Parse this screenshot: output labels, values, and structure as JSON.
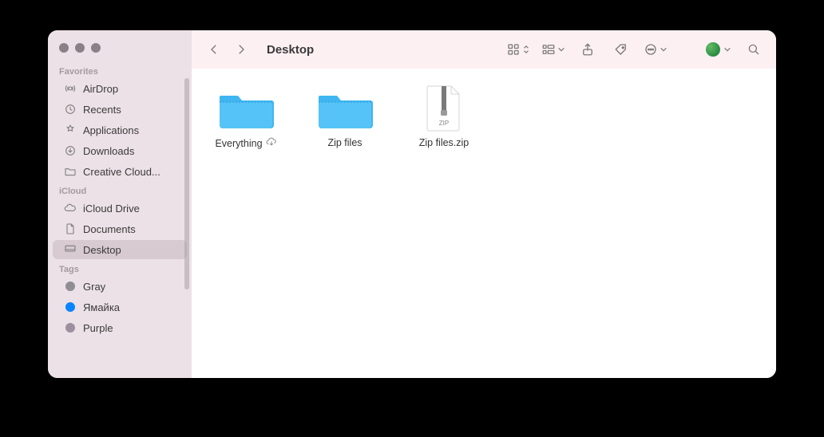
{
  "window": {
    "title": "Desktop"
  },
  "sidebar": {
    "sections": [
      {
        "title": "Favorites",
        "items": [
          {
            "icon": "airdrop",
            "label": "AirDrop"
          },
          {
            "icon": "recents",
            "label": "Recents"
          },
          {
            "icon": "applications",
            "label": "Applications"
          },
          {
            "icon": "downloads",
            "label": "Downloads"
          },
          {
            "icon": "folder",
            "label": "Creative Cloud..."
          }
        ]
      },
      {
        "title": "iCloud",
        "items": [
          {
            "icon": "icloud",
            "label": "iCloud Drive"
          },
          {
            "icon": "document",
            "label": "Documents"
          },
          {
            "icon": "desktop",
            "label": "Desktop",
            "selected": true
          }
        ]
      },
      {
        "title": "Tags",
        "items": [
          {
            "icon": "tag",
            "label": "Gray",
            "color": "#8e8e93"
          },
          {
            "icon": "tag",
            "label": "Ямайка",
            "color": "#0a84ff"
          },
          {
            "icon": "tag",
            "label": "Purple",
            "color": "#9e8e9e"
          }
        ]
      }
    ]
  },
  "toolbar": {
    "view_icon": "grid",
    "group_icon": "group",
    "share_icon": "share",
    "tag_icon": "tag",
    "action_icon": "action",
    "search_icon": "search"
  },
  "items": [
    {
      "type": "folder",
      "label": "Everything",
      "cloud": true
    },
    {
      "type": "folder",
      "label": "Zip files",
      "cloud": false
    },
    {
      "type": "zip",
      "label": "Zip files.zip",
      "cloud": false
    }
  ]
}
